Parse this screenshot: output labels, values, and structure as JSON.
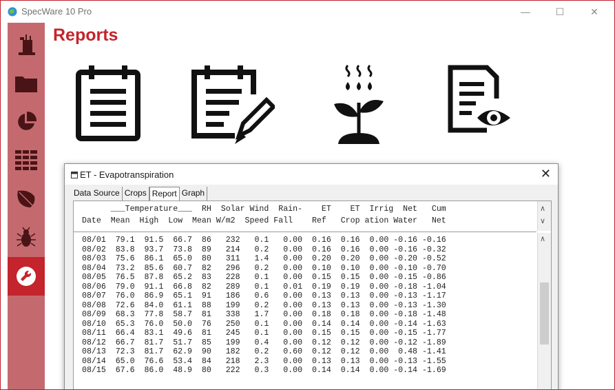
{
  "app": {
    "title": "SpecWare 10 Pro"
  },
  "window_controls": {
    "minimize": "—",
    "maximize": "☐",
    "close": "✕"
  },
  "sidebar": {
    "items": [
      {
        "icon": "weather-station-icon"
      },
      {
        "icon": "folder-icon"
      },
      {
        "icon": "pie-chart-icon"
      },
      {
        "icon": "table-icon"
      },
      {
        "icon": "leaf-icon"
      },
      {
        "icon": "bug-icon"
      },
      {
        "icon": "wrench-icon",
        "active": true
      }
    ]
  },
  "page": {
    "title": "Reports",
    "report_icons": [
      "clipboard-icon",
      "clipboard-edit-icon",
      "plant-irrigation-icon",
      "report-view-icon"
    ]
  },
  "dialog": {
    "title": "ET - Evapotranspiration",
    "close": "✕",
    "tabs": [
      "Data Source",
      "Crops",
      "Report",
      "Graph"
    ],
    "active_tab": "Report",
    "header_line1": "      ___Temperature___  RH  Solar Wind  Rain-    ET    ET  Irrig  Net   Cum",
    "header_line2": "Date  Mean  High  Low  Mean W/m2  Speed Fall    Ref   Crop ation Water   Net",
    "rows": [
      "08/01  79.1  91.5  66.7  86   232   0.1   0.00  0.16  0.16  0.00 -0.16 -0.16",
      "08/02  83.8  93.7  73.8  89   214   0.2   0.00  0.16  0.16  0.00 -0.16 -0.32",
      "08/03  75.6  86.1  65.0  80   311   1.4   0.00  0.20  0.20  0.00 -0.20 -0.52",
      "08/04  73.2  85.6  60.7  82   296   0.2   0.00  0.10  0.10  0.00 -0.10 -0.70",
      "08/05  76.5  87.8  65.2  83   228   0.1   0.00  0.15  0.15  0.00 -0.15 -0.86",
      "08/06  79.0  91.1  66.8  82   289   0.1   0.01  0.19  0.19  0.00 -0.18 -1.04",
      "08/07  76.0  86.9  65.1  91   186   0.6   0.00  0.13  0.13  0.00 -0.13 -1.17",
      "08/08  72.6  84.0  61.1  88   199   0.2   0.00  0.13  0.13  0.00 -0.13 -1.30",
      "08/09  68.3  77.8  58.7  81   338   1.7   0.00  0.18  0.18  0.00 -0.18 -1.48",
      "08/10  65.3  76.0  50.0  76   250   0.1   0.00  0.14  0.14  0.00 -0.14 -1.63",
      "08/11  66.4  83.1  49.6  81   245   0.1   0.00  0.15  0.15  0.00 -0.15 -1.77",
      "08/12  66.7  81.7  51.7  85   199   0.4   0.00  0.12  0.12  0.00 -0.12 -1.89",
      "08/13  72.3  81.7  62.9  90   182   0.2   0.60  0.12  0.12  0.00  0.48 -1.41",
      "08/14  65.0  76.6  53.4  84   218   2.3   0.00  0.13  0.13  0.00 -0.13 -1.55",
      "08/15  67.6  86.0  48.9  80   222   0.3   0.00  0.14  0.14  0.00 -0.14 -1.69"
    ]
  },
  "colors": {
    "brand_red": "#c4242c",
    "sidebar_red": "#c46a6f"
  },
  "scroll_arrows": {
    "up": "∧",
    "down": "∨"
  }
}
